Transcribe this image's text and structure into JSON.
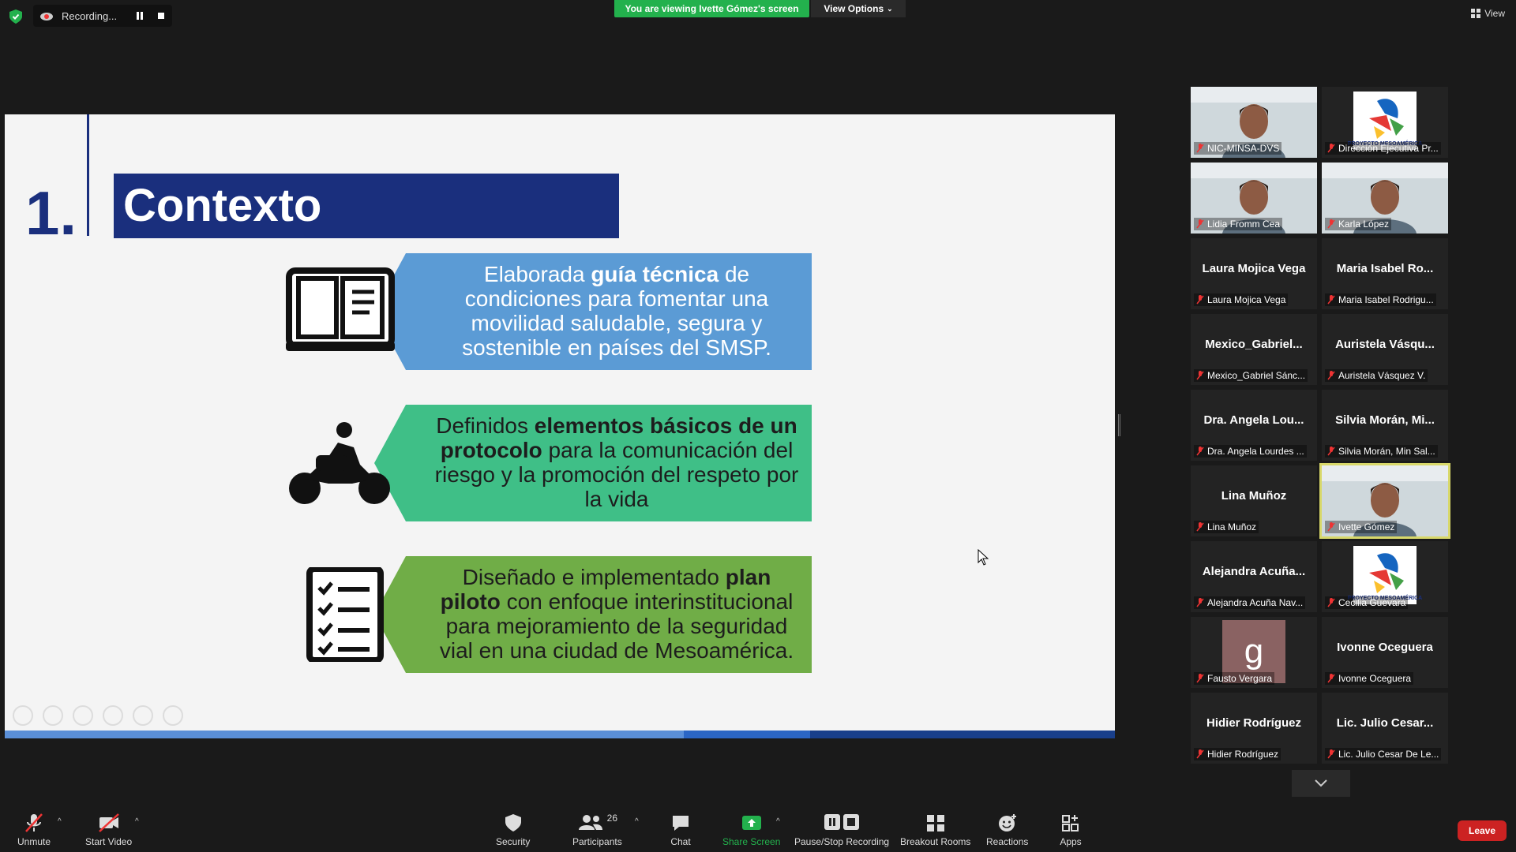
{
  "topbar": {
    "recording_label": "Recording...",
    "viewing_banner": "You are viewing Ivette Gómez's screen",
    "view_options": "View Options",
    "view_label": "View"
  },
  "slide": {
    "number": "1.",
    "title": "Contexto",
    "rows": [
      {
        "pre": "Elaborada ",
        "bold": "guía técnica",
        "post": " de condiciones para fomentar una movilidad saludable, segura y sostenible en países del SMSP.",
        "color": "#5b9bd5",
        "icon": "book-icon"
      },
      {
        "pre": "Definidos ",
        "bold": "elementos básicos de un protocolo",
        "post": " para la comunicación del riesgo y la promoción del respeto por la vida",
        "color": "#3fbf87",
        "icon": "motorcycle-icon"
      },
      {
        "pre": "Diseñado e implementado ",
        "bold": "plan piloto",
        "post": " con enfoque interinstitucional para mejoramiento de la seguridad vial en una ciudad de Mesoamérica.",
        "color": "#70ad47",
        "icon": "checklist-icon"
      }
    ]
  },
  "participants": [
    {
      "name": "",
      "label": "NIC-MINSA-DVS",
      "video": "person"
    },
    {
      "name": "",
      "label": "Dirección Ejecutiva Pr...",
      "video": "logo"
    },
    {
      "name": "",
      "label": "Lidia Fromm Cea",
      "video": "person"
    },
    {
      "name": "",
      "label": "Karla López",
      "video": "person"
    },
    {
      "name": "Laura Mojica Vega",
      "label": "Laura Mojica Vega",
      "video": ""
    },
    {
      "name": "Maria Isabel Ro...",
      "label": "Maria Isabel Rodrigu...",
      "video": ""
    },
    {
      "name": "Mexico_Gabriel...",
      "label": "Mexico_Gabriel Sánc...",
      "video": ""
    },
    {
      "name": "Auristela Vásqu...",
      "label": "Auristela Vásquez V.",
      "video": ""
    },
    {
      "name": "Dra. Angela Lou...",
      "label": "Dra. Angela Lourdes ...",
      "video": ""
    },
    {
      "name": "Silvia Morán, Mi...",
      "label": "Silvia Morán, Min Sal...",
      "video": ""
    },
    {
      "name": "Lina Muñoz",
      "label": "Lina Muñoz",
      "video": ""
    },
    {
      "name": "",
      "label": "Ivette Gómez",
      "video": "person"
    },
    {
      "name": "Alejandra Acuña...",
      "label": "Alejandra Acuña Nav...",
      "video": ""
    },
    {
      "name": "",
      "label": "Cecilia Guevara",
      "video": "logo"
    },
    {
      "name": "",
      "label": "Fausto Vergara",
      "video": "avatar-g"
    },
    {
      "name": "Ivonne Oceguera",
      "label": "Ivonne Oceguera",
      "video": ""
    },
    {
      "name": "Hidier Rodríguez",
      "label": "Hidier Rodríguez",
      "video": ""
    },
    {
      "name": "Lic. Julio Cesar...",
      "label": "Lic. Julio Cesar De Le...",
      "video": ""
    }
  ],
  "avatar_letter": "g",
  "logo_text": "PROYECTO MESOAMÉRICA",
  "toolbar": {
    "unmute": "Unmute",
    "start_video": "Start Video",
    "security": "Security",
    "participants": "Participants",
    "participants_count": "26",
    "chat": "Chat",
    "share_screen": "Share Screen",
    "pause_stop": "Pause/Stop Recording",
    "breakout": "Breakout Rooms",
    "reactions": "Reactions",
    "apps": "Apps",
    "leave": "Leave"
  },
  "colors": {
    "accent_green": "#23b14d",
    "leave_red": "#cc2222",
    "slide_navy": "#1a2f7d"
  }
}
